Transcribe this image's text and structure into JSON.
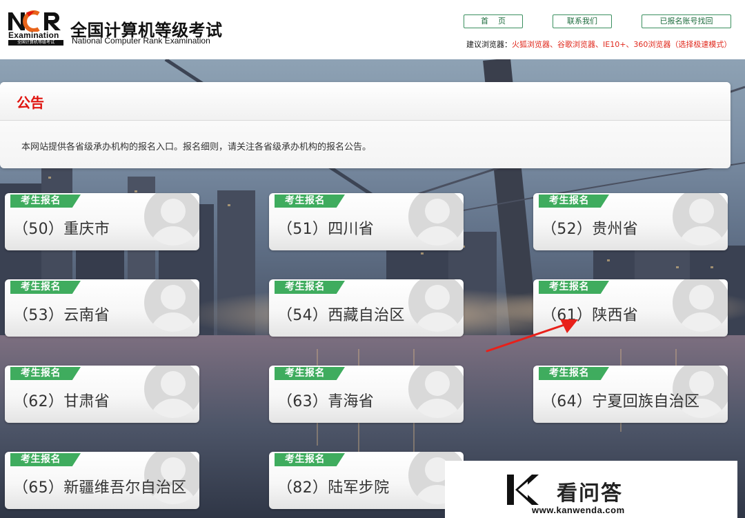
{
  "header": {
    "logo_text": "NCR",
    "logo_sub": "Examination",
    "logo_strip": "全国计算机等级考试",
    "site_title": "全国计算机等级考试",
    "site_subtitle": "National Computer Rank Examination",
    "nav": {
      "home": "首页",
      "contact": "联系我们",
      "recover": "已报名账号找回"
    },
    "browser_tip_label": "建议浏览器：",
    "browser_tip_list": "火狐浏览器、谷歌浏览器、IE10+、360浏览器（选择极速模式）"
  },
  "notice": {
    "title": "公告",
    "body": "本网站提供各省级承办机构的报名入口。报名细则，请关注各省级承办机构的报名公告。"
  },
  "cards": [
    {
      "badge": "考生报名",
      "name": "（50）重庆市"
    },
    {
      "badge": "考生报名",
      "name": "（51）四川省"
    },
    {
      "badge": "考生报名",
      "name": "（52）贵州省"
    },
    {
      "badge": "考生报名",
      "name": "（53）云南省"
    },
    {
      "badge": "考生报名",
      "name": "（54）西藏自治区"
    },
    {
      "badge": "考生报名",
      "name": "（61）陕西省"
    },
    {
      "badge": "考生报名",
      "name": "（62）甘肃省"
    },
    {
      "badge": "考生报名",
      "name": "（63）青海省"
    },
    {
      "badge": "考生报名",
      "name": "（64）宁夏回族自治区"
    },
    {
      "badge": "考生报名",
      "name": "（65）新疆维吾尔自治区"
    },
    {
      "badge": "考生报名",
      "name": "（82）陆军步院"
    }
  ],
  "watermark": {
    "name": "看问答",
    "url": "www.kanwenda.com"
  },
  "colors": {
    "accent_red": "#e0140f",
    "badge_green": "#3fac5e",
    "nav_border": "#3a8f5e",
    "arrow_red": "#e8201a"
  },
  "icons": [
    "ncr-logo-icon",
    "avatar-placeholder-icon",
    "annotation-arrow-icon",
    "kanwenda-logo-icon"
  ]
}
